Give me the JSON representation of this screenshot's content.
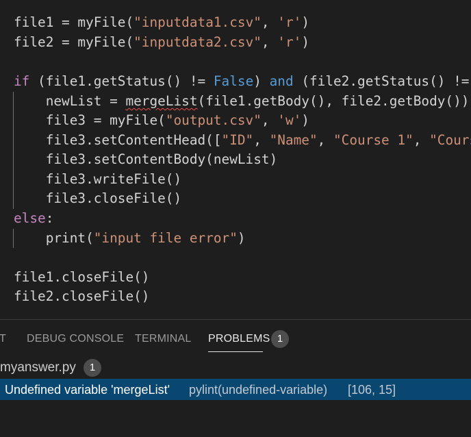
{
  "editor": {
    "lines": [
      [
        {
          "t": "file1 = myFile(",
          "c": "plain"
        },
        {
          "t": "\"inputdata1.csv\"",
          "c": "str"
        },
        {
          "t": ", ",
          "c": "plain"
        },
        {
          "t": "'r'",
          "c": "str"
        },
        {
          "t": ")",
          "c": "plain"
        }
      ],
      [
        {
          "t": "file2 = myFile(",
          "c": "plain"
        },
        {
          "t": "\"inputdata2.csv\"",
          "c": "str"
        },
        {
          "t": ", ",
          "c": "plain"
        },
        {
          "t": "'r'",
          "c": "str"
        },
        {
          "t": ")",
          "c": "plain"
        }
      ],
      [],
      [
        {
          "t": "if",
          "c": "ctrl"
        },
        {
          "t": " (file1.getStatus() != ",
          "c": "plain"
        },
        {
          "t": "False",
          "c": "kw"
        },
        {
          "t": ") ",
          "c": "plain"
        },
        {
          "t": "and",
          "c": "kw"
        },
        {
          "t": " (file2.getStatus() != ",
          "c": "plain"
        }
      ],
      [
        {
          "t": "    newList = ",
          "c": "plain"
        },
        {
          "t": "mergeList",
          "c": "err"
        },
        {
          "t": "(file1.getBody(), file2.getBody())",
          "c": "plain"
        }
      ],
      [
        {
          "t": "    file3 = myFile(",
          "c": "plain"
        },
        {
          "t": "\"output.csv\"",
          "c": "str"
        },
        {
          "t": ", ",
          "c": "plain"
        },
        {
          "t": "'w'",
          "c": "str"
        },
        {
          "t": ")",
          "c": "plain"
        }
      ],
      [
        {
          "t": "    file3.setContentHead([",
          "c": "plain"
        },
        {
          "t": "\"ID\"",
          "c": "str"
        },
        {
          "t": ", ",
          "c": "plain"
        },
        {
          "t": "\"Name\"",
          "c": "str"
        },
        {
          "t": ", ",
          "c": "plain"
        },
        {
          "t": "\"Course 1\"",
          "c": "str"
        },
        {
          "t": ", ",
          "c": "plain"
        },
        {
          "t": "\"Cours",
          "c": "str"
        }
      ],
      [
        {
          "t": "    file3.setContentBody(newList)",
          "c": "plain"
        }
      ],
      [
        {
          "t": "    file3.writeFile()",
          "c": "plain"
        }
      ],
      [
        {
          "t": "    file3.closeFile()",
          "c": "plain"
        }
      ],
      [
        {
          "t": "else",
          "c": "ctrl"
        },
        {
          "t": ":",
          "c": "plain"
        }
      ],
      [
        {
          "t": "    print(",
          "c": "plain"
        },
        {
          "t": "\"input file error\"",
          "c": "str"
        },
        {
          "t": ")",
          "c": "plain"
        }
      ],
      [],
      [
        {
          "t": "file1.closeFile()",
          "c": "plain"
        }
      ],
      [
        {
          "t": "file2.closeFile()",
          "c": "plain"
        }
      ]
    ],
    "colors": {
      "background": "#1e1e1e",
      "text": "#d4d4d4",
      "keyword": "#569cd6",
      "control": "#c586c0",
      "string": "#ce9178",
      "error_squiggle": "#f14c4c"
    }
  },
  "panel": {
    "tabs": [
      {
        "label": "T",
        "active": false
      },
      {
        "label": "DEBUG CONSOLE",
        "active": false
      },
      {
        "label": "TERMINAL",
        "active": false
      },
      {
        "label": "PROBLEMS",
        "active": true
      }
    ],
    "problems_count": "1",
    "file": {
      "name": "myanswer.py",
      "count": "1"
    },
    "problem": {
      "message": "Undefined variable 'mergeList'",
      "source": "pylint(undefined-variable)",
      "position": "[106, 15]"
    },
    "colors": {
      "selected_row": "#094771",
      "badge": "#4d4d4d"
    }
  }
}
